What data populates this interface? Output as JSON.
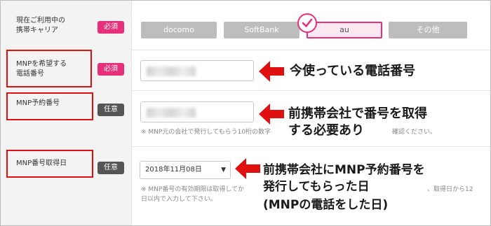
{
  "rows": {
    "carrier": {
      "label": "現在ご利用中の\n携帯キャリア",
      "badge": "必須",
      "options": [
        "docomo",
        "SoftBank",
        "au",
        "その他"
      ],
      "selected": "au"
    },
    "mnp_phone": {
      "label": "MNPを希望する\n電話番号",
      "badge": "必須"
    },
    "mnp_reserve": {
      "label": "MNP予約番号",
      "badge": "任意",
      "note_left": "※ MNP元の会社で発行してもらう10桁の数字",
      "note_right": "確認ください。"
    },
    "mnp_date": {
      "label": "MNP番号取得日",
      "badge": "任意",
      "select_value": "2018年11月08日",
      "note_line1_left": "※ MNP番号の有効期限は取得してか",
      "note_line1_right": "、取得日から12",
      "note_line2": "日以内で入力して下さい。"
    }
  },
  "callouts": {
    "phone": "今使っている電話番号",
    "reserve_line1": "前携帯会社で番号を取得",
    "reserve_line2": "する必要あり",
    "date_line1": "前携帯会社にMNP予約番号を",
    "date_line2": "発行してもらった日",
    "date_line3": "(MNPの電話をした日)"
  },
  "colors": {
    "required_badge": "#e8307a",
    "optional_badge": "#555555",
    "highlight_box": "#e01010",
    "arrow": "#e01010"
  },
  "icons": {
    "selected_check": "check-icon",
    "select_dropdown": "chevron-down-icon",
    "callout_arrow": "arrow-left-icon"
  }
}
